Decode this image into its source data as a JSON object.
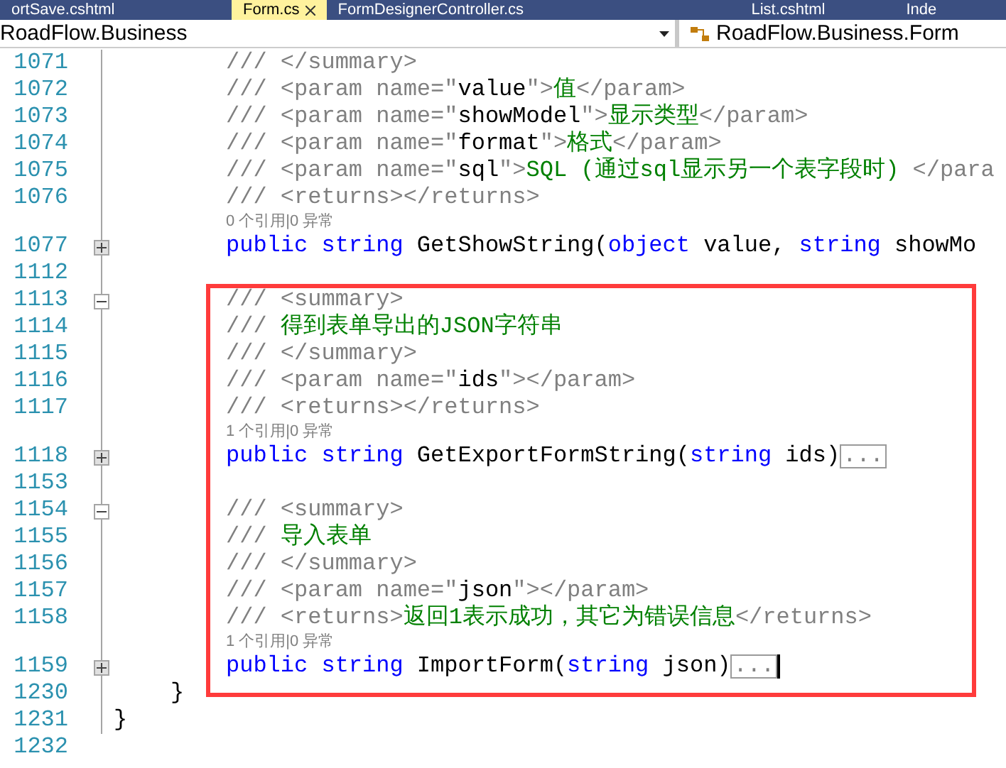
{
  "tabs": [
    {
      "label": "ortSave.cshtml",
      "selected": false
    },
    {
      "label": "Form.cs",
      "selected": true
    },
    {
      "label": "FormDesignerController.cs",
      "selected": false
    },
    {
      "label": "List.cshtml",
      "selected": false
    },
    {
      "label": "Inde",
      "selected": false
    }
  ],
  "navigation": {
    "project": "RoadFlow.Business",
    "type": "RoadFlow.Business.Form"
  },
  "editor": {
    "lines": [
      {
        "kind": "member",
        "number": "1071",
        "segments": [
          {
            "kind": "doc",
            "text": "/// </summary>"
          }
        ]
      },
      {
        "kind": "member",
        "number": "1072",
        "segments": [
          {
            "kind": "doc",
            "text": "/// <param name=\""
          },
          {
            "kind": "doc-value",
            "text": "value"
          },
          {
            "kind": "doc",
            "text": "\">"
          },
          {
            "kind": "doc-text",
            "text": "值"
          },
          {
            "kind": "doc",
            "text": "</param>"
          }
        ]
      },
      {
        "kind": "member",
        "number": "1073",
        "segments": [
          {
            "kind": "doc",
            "text": "/// <param name=\""
          },
          {
            "kind": "doc-value",
            "text": "showModel"
          },
          {
            "kind": "doc",
            "text": "\">"
          },
          {
            "kind": "doc-text",
            "text": "显示类型"
          },
          {
            "kind": "doc",
            "text": "</param>"
          }
        ]
      },
      {
        "kind": "member",
        "number": "1074",
        "segments": [
          {
            "kind": "doc",
            "text": "/// <param name=\""
          },
          {
            "kind": "doc-value",
            "text": "format"
          },
          {
            "kind": "doc",
            "text": "\">"
          },
          {
            "kind": "doc-text",
            "text": "格式"
          },
          {
            "kind": "doc",
            "text": "</param>"
          }
        ]
      },
      {
        "kind": "member",
        "number": "1075",
        "segments": [
          {
            "kind": "doc",
            "text": "/// <param name=\""
          },
          {
            "kind": "doc-value",
            "text": "sql"
          },
          {
            "kind": "doc",
            "text": "\">"
          },
          {
            "kind": "doc-text",
            "text": "SQL (通过sql显示另一个表字段时) "
          },
          {
            "kind": "doc",
            "text": "</para"
          }
        ]
      },
      {
        "kind": "member",
        "number": "1076",
        "segments": [
          {
            "kind": "doc",
            "text": "/// <returns></returns>"
          }
        ]
      },
      {
        "kind": "lens",
        "text": "0 个引用|0 异常"
      },
      {
        "kind": "member",
        "number": "1077",
        "collapsed": true,
        "segments": [
          {
            "kind": "keyword",
            "text": "public string"
          },
          {
            "kind": "plain",
            "text": " GetShowString("
          },
          {
            "kind": "keyword",
            "text": "object"
          },
          {
            "kind": "plain",
            "text": " value, "
          },
          {
            "kind": "keyword",
            "text": "string"
          },
          {
            "kind": "plain",
            "text": " showMo"
          }
        ]
      },
      {
        "kind": "member",
        "number": "1112"
      },
      {
        "kind": "member",
        "number": "1113",
        "collapsed": false,
        "segments": [
          {
            "kind": "doc",
            "text": "/// <summary>"
          }
        ]
      },
      {
        "kind": "member",
        "number": "1114",
        "segments": [
          {
            "kind": "doc",
            "text": "/// "
          },
          {
            "kind": "doc-text",
            "text": "得到表单导出的JSON字符串"
          }
        ]
      },
      {
        "kind": "member",
        "number": "1115",
        "segments": [
          {
            "kind": "doc",
            "text": "/// </summary>"
          }
        ]
      },
      {
        "kind": "member",
        "number": "1116",
        "segments": [
          {
            "kind": "doc",
            "text": "/// <param name=\""
          },
          {
            "kind": "doc-value",
            "text": "ids"
          },
          {
            "kind": "doc",
            "text": "\"></param>"
          }
        ]
      },
      {
        "kind": "member",
        "number": "1117",
        "segments": [
          {
            "kind": "doc",
            "text": "/// <returns></returns>"
          }
        ]
      },
      {
        "kind": "lens",
        "text": "1 个引用|0 异常"
      },
      {
        "kind": "member",
        "number": "1118",
        "collapsed": true,
        "segments": [
          {
            "kind": "keyword",
            "text": "public string"
          },
          {
            "kind": "plain",
            "text": " GetExportFormString("
          },
          {
            "kind": "keyword",
            "text": "string"
          },
          {
            "kind": "plain",
            "text": " ids)"
          },
          {
            "kind": "collapsed",
            "text": "..."
          }
        ]
      },
      {
        "kind": "member",
        "number": "1153"
      },
      {
        "kind": "member",
        "number": "1154",
        "collapsed": false,
        "segments": [
          {
            "kind": "doc",
            "text": "/// <summary>"
          }
        ]
      },
      {
        "kind": "member",
        "number": "1155",
        "segments": [
          {
            "kind": "doc",
            "text": "/// "
          },
          {
            "kind": "doc-text",
            "text": "导入表单"
          }
        ]
      },
      {
        "kind": "member",
        "number": "1156",
        "segments": [
          {
            "kind": "doc",
            "text": "/// </summary>"
          }
        ]
      },
      {
        "kind": "member",
        "number": "1157",
        "segments": [
          {
            "kind": "doc",
            "text": "/// <param name=\""
          },
          {
            "kind": "doc-value",
            "text": "json"
          },
          {
            "kind": "doc",
            "text": "\"></param>"
          }
        ]
      },
      {
        "kind": "member",
        "number": "1158",
        "segments": [
          {
            "kind": "doc",
            "text": "/// <returns>"
          },
          {
            "kind": "doc-text",
            "text": "返回1表示成功，其它为错误信息"
          },
          {
            "kind": "doc",
            "text": "</returns>"
          }
        ]
      },
      {
        "kind": "lens",
        "text": "1 个引用|0 异常"
      },
      {
        "kind": "member",
        "number": "1159",
        "collapsed": true,
        "cursor": true,
        "segments": [
          {
            "kind": "keyword",
            "text": "public string"
          },
          {
            "kind": "plain",
            "text": " ImportForm("
          },
          {
            "kind": "keyword",
            "text": "string"
          },
          {
            "kind": "plain",
            "text": " json)"
          },
          {
            "kind": "collapsed",
            "text": "..."
          }
        ]
      },
      {
        "kind": "class",
        "number": "1230",
        "segments": [
          {
            "kind": "plain",
            "text": "}"
          }
        ]
      },
      {
        "kind": "namespace",
        "number": "1231",
        "segments": [
          {
            "kind": "plain",
            "text": "}"
          }
        ]
      },
      {
        "kind": "blank",
        "number": "1232"
      }
    ]
  }
}
